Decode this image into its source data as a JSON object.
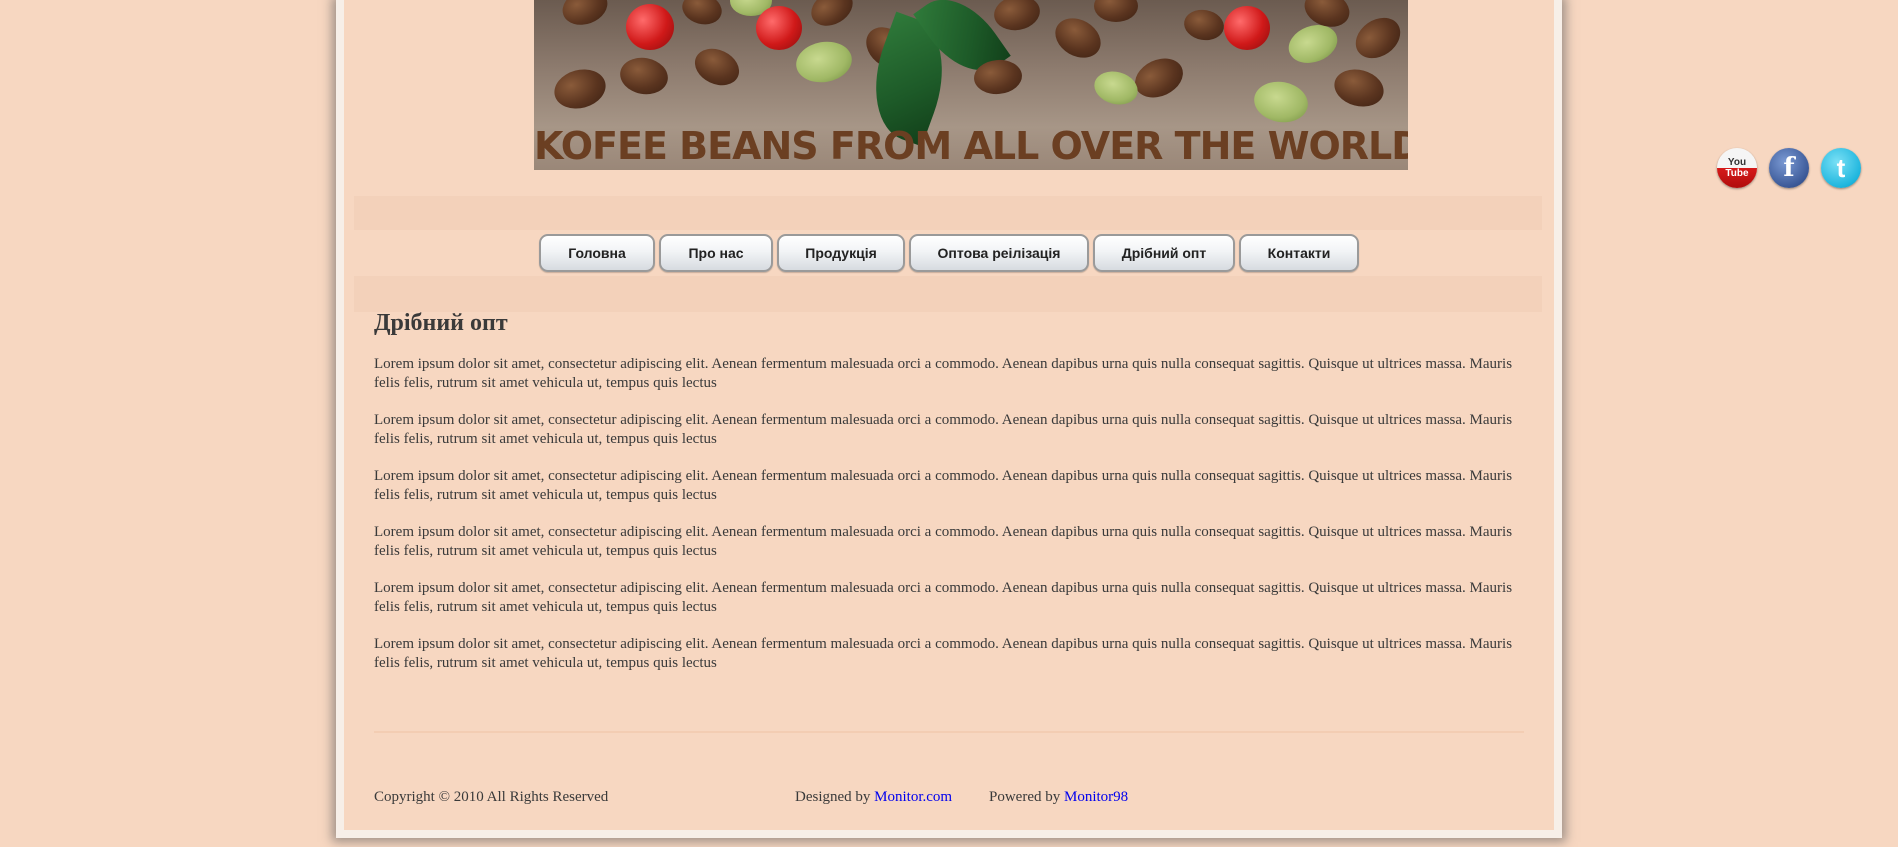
{
  "banner": {
    "title": "KOFEE BEANS FROM ALL OVER THE WORLD"
  },
  "nav": {
    "items": [
      {
        "label": "Головна"
      },
      {
        "label": "Про нас"
      },
      {
        "label": "Продукція"
      },
      {
        "label": "Оптова реілізація"
      },
      {
        "label": "Дрібний опт"
      },
      {
        "label": "Контакти"
      }
    ]
  },
  "content": {
    "heading": "Дрібний опт",
    "paragraphs": [
      "Lorem ipsum dolor sit amet, consectetur adipiscing elit. Aenean fermentum malesuada orci a commodo. Aenean dapibus urna quis nulla consequat sagittis. Quisque ut ultrices massa. Mauris felis felis, rutrum sit amet vehicula ut, tempus quis lectus",
      "Lorem ipsum dolor sit amet, consectetur adipiscing elit. Aenean fermentum malesuada orci a commodo. Aenean dapibus urna quis nulla consequat sagittis. Quisque ut ultrices massa. Mauris felis felis, rutrum sit amet vehicula ut, tempus quis lectus",
      "Lorem ipsum dolor sit amet, consectetur adipiscing elit. Aenean fermentum malesuada orci a commodo. Aenean dapibus urna quis nulla consequat sagittis. Quisque ut ultrices massa. Mauris felis felis, rutrum sit amet vehicula ut, tempus quis lectus",
      "Lorem ipsum dolor sit amet, consectetur adipiscing elit. Aenean fermentum malesuada orci a commodo. Aenean dapibus urna quis nulla consequat sagittis. Quisque ut ultrices massa. Mauris felis felis, rutrum sit amet vehicula ut, tempus quis lectus",
      "Lorem ipsum dolor sit amet, consectetur adipiscing elit. Aenean fermentum malesuada orci a commodo. Aenean dapibus urna quis nulla consequat sagittis. Quisque ut ultrices massa. Mauris felis felis, rutrum sit amet vehicula ut, tempus quis lectus",
      "Lorem ipsum dolor sit amet, consectetur adipiscing elit. Aenean fermentum malesuada orci a commodo. Aenean dapibus urna quis nulla consequat sagittis. Quisque ut ultrices massa. Mauris felis felis, rutrum sit amet vehicula ut, tempus quis lectus"
    ]
  },
  "footer": {
    "copyright": "Copyright © 2010 All Rights Reserved",
    "designed_prefix": "Designed by",
    "designed_link": "Monitor.com",
    "powered_prefix": "Powered by",
    "powered_link": "Monitor98"
  },
  "social": {
    "youtube_top": "You",
    "youtube_bottom": "Tube",
    "facebook_glyph": "f",
    "twitter_glyph": "t",
    "icons": [
      "youtube-icon",
      "facebook-icon",
      "twitter-icon"
    ]
  },
  "colors": {
    "background": "#f7d7c1",
    "frame_border": "#f7efe8",
    "text": "#3a3a3a",
    "link": "#0000ee",
    "banner_title": "#6b3f22"
  }
}
